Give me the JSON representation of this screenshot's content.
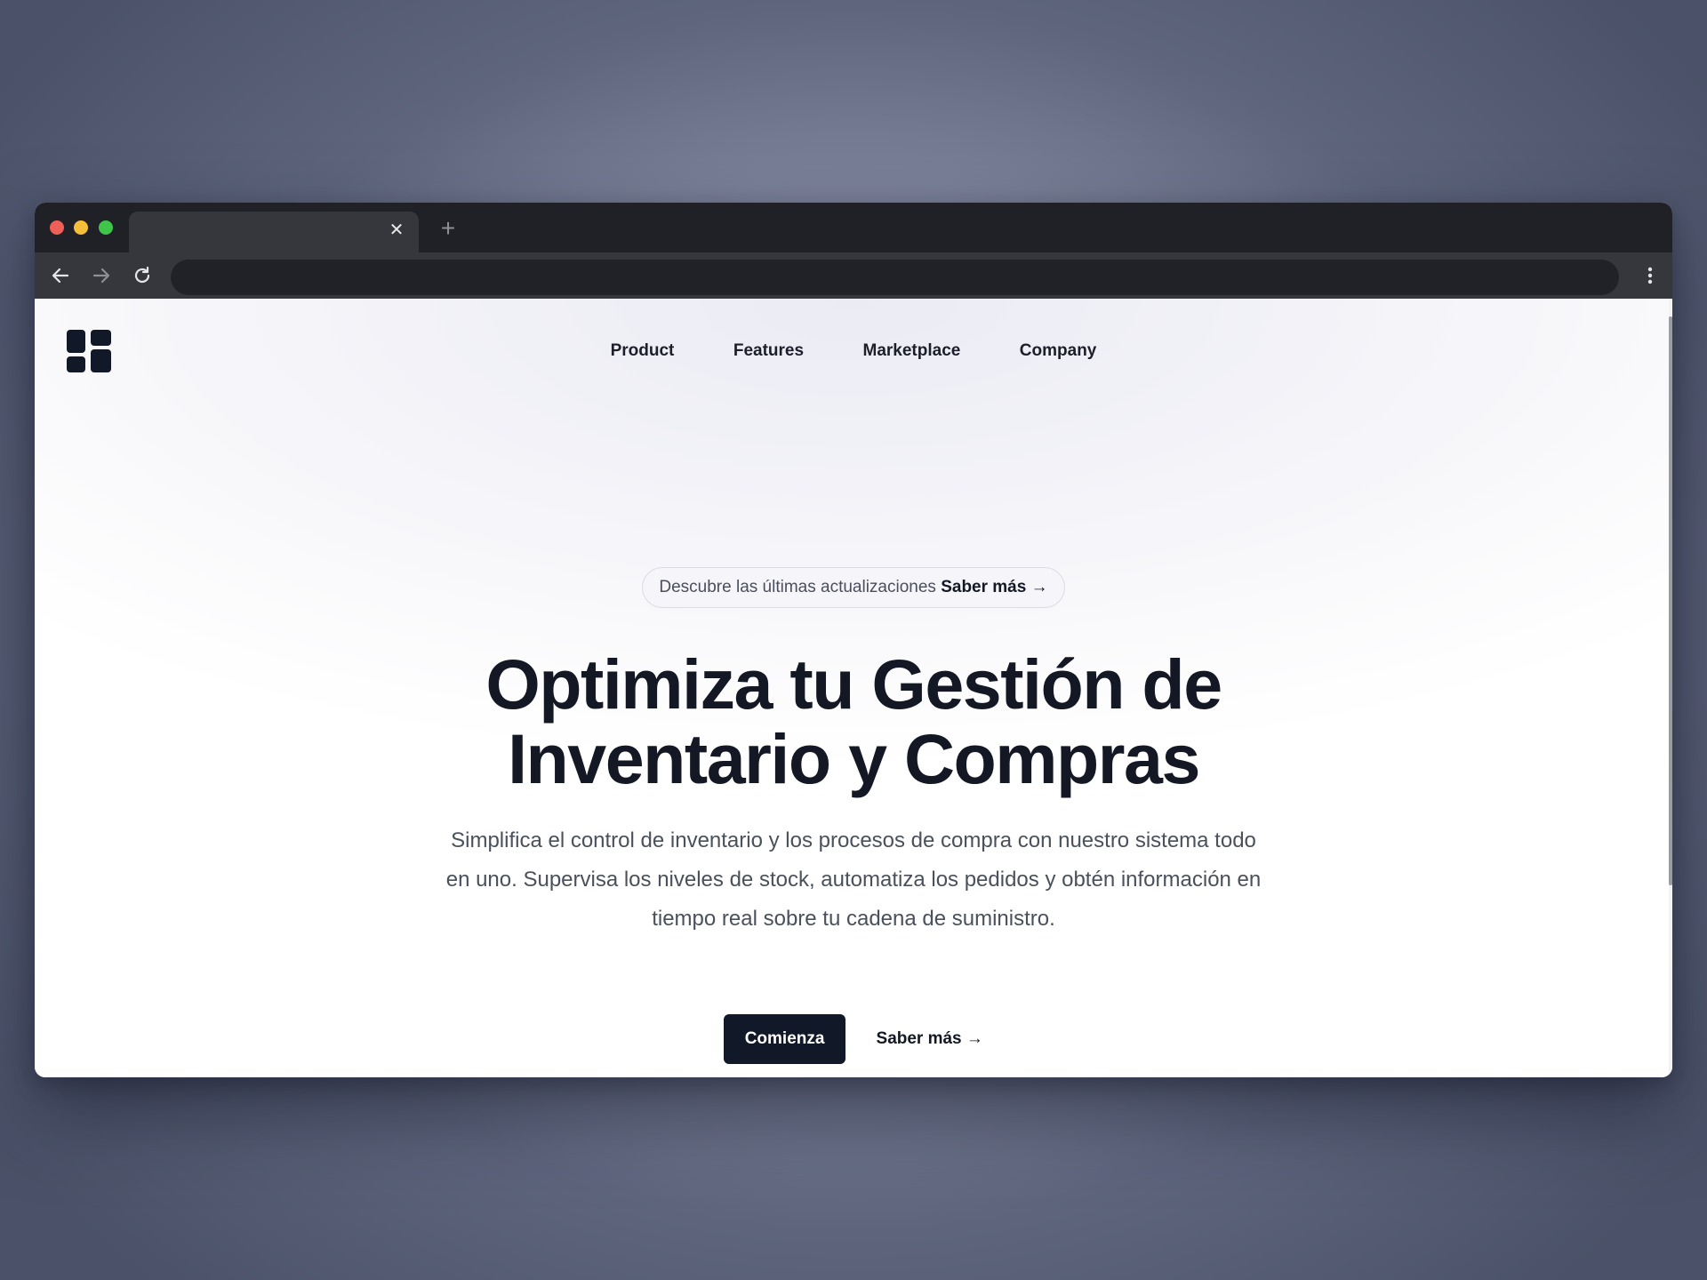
{
  "browser": {
    "tab": {
      "title": "",
      "close_glyph": "✕"
    },
    "new_tab_glyph": "+",
    "address": {
      "value": ""
    },
    "icons": [
      "back-arrow-icon",
      "forward-arrow-icon",
      "reload-icon",
      "more-vert-icon"
    ]
  },
  "header": {
    "logo_icon": "grid-logo-icon",
    "nav": [
      {
        "label": "Product"
      },
      {
        "label": "Features"
      },
      {
        "label": "Marketplace"
      },
      {
        "label": "Company"
      }
    ]
  },
  "hero": {
    "announcement": {
      "text": "Descubre las últimas actualizaciones",
      "link": "Saber más →"
    },
    "title_line1": "Optimiza tu Gestión de",
    "title_line2": "Inventario y Compras",
    "subtitle": "Simplifica el control de inventario y los procesos de compra con nuestro sistema todo en uno. Supervisa los niveles de stock, automatiza los pedidos y obtén información en tiempo real sobre tu cadena de suministro.",
    "primary_cta": "Comienza",
    "secondary_cta": "Saber más →"
  },
  "colors": {
    "brand_dark": "#111827",
    "chrome_dark": "#1f2127",
    "chrome_toolbar": "#35373d",
    "traffic_red": "#ee5f57",
    "traffic_yellow": "#f6bd3b",
    "traffic_green": "#40c54b"
  }
}
